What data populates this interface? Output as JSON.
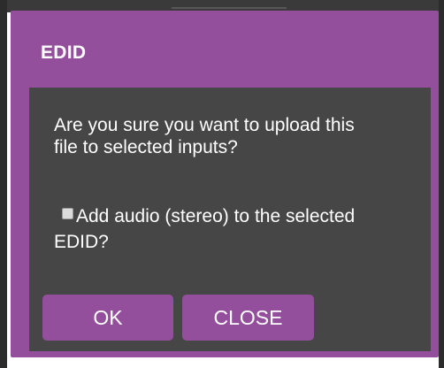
{
  "colors": {
    "dialog_accent": "#934f9b",
    "dialog_body": "#464646",
    "text": "#ffffff"
  },
  "dialog": {
    "title": "EDID",
    "message": "Are you sure you want to upload this file to selected inputs?",
    "audio_option": {
      "label": "Add audio (stereo) to the selected EDID?",
      "checked": false
    },
    "buttons": {
      "ok_label": "OK",
      "close_label": "CLOSE"
    }
  }
}
